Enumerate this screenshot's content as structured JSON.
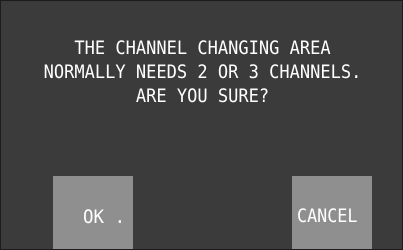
{
  "dialog": {
    "message_lines": [
      "THE CHANNEL CHANGING AREA",
      "NORMALLY NEEDS 2 OR 3 CHANNELS.",
      "ARE YOU SURE?"
    ],
    "ok_label": "OK .",
    "cancel_label": "CANCEL"
  },
  "colors": {
    "background": "#3b3b3b",
    "button": "#8f8f8f",
    "text": "#ffffff"
  }
}
